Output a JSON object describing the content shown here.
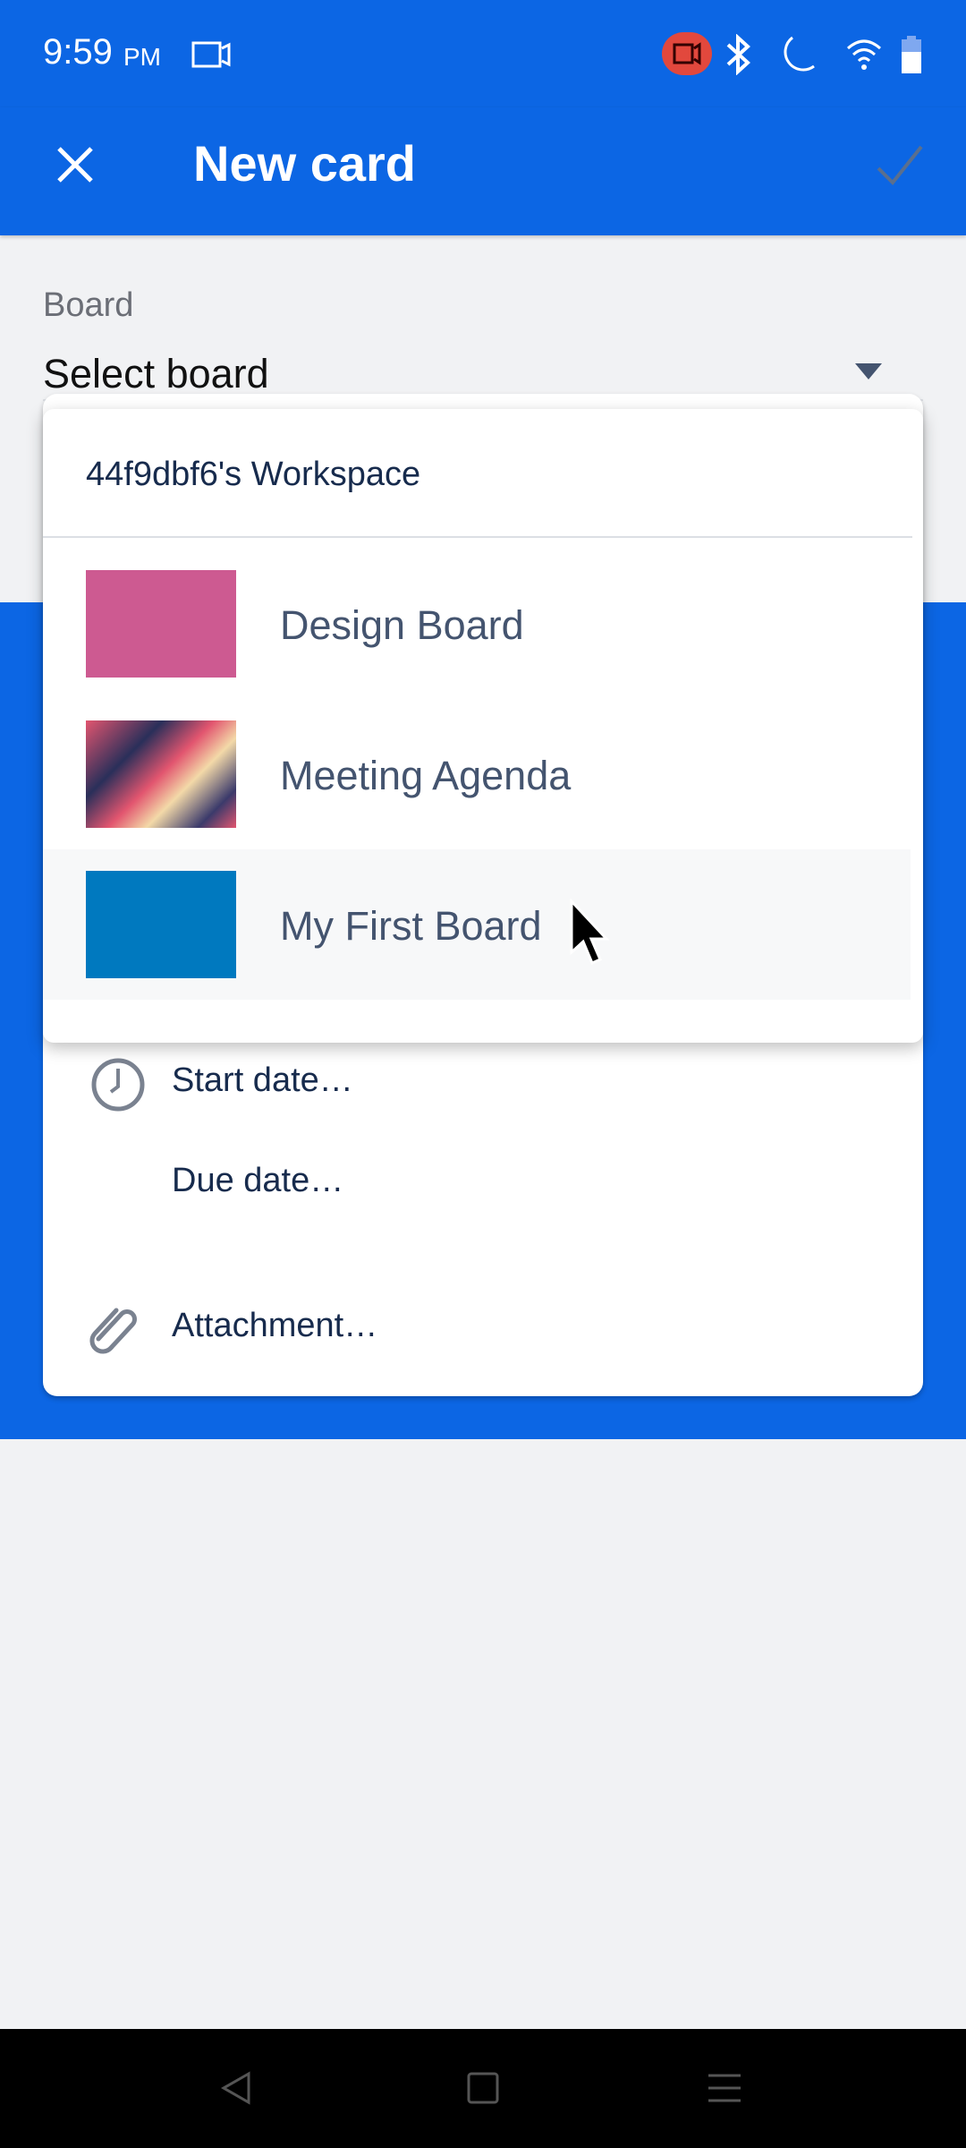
{
  "status_bar": {
    "time": "9:59",
    "ampm": "PM",
    "icons": [
      "screen-record-icon",
      "recording-icon",
      "bluetooth-icon",
      "do-not-disturb-icon",
      "wifi-icon",
      "battery-icon"
    ]
  },
  "app_bar": {
    "title": "New card",
    "close_icon": "close-icon",
    "confirm_icon": "check-icon"
  },
  "board_field": {
    "label": "Board",
    "value": "Select board"
  },
  "dropdown": {
    "workspace": "44f9dbf6's Workspace",
    "boards": [
      {
        "name": "Design Board",
        "color": "#cd5a91"
      },
      {
        "name": "Meeting Agenda",
        "color": "#e2556f"
      },
      {
        "name": "My First Board",
        "color": "#0079bf",
        "highlighted": true
      }
    ]
  },
  "options": {
    "start_date": "Start date…",
    "due_date": "Due date…",
    "attachment": "Attachment…"
  },
  "colors": {
    "primary": "#0c66e4",
    "background": "#f1f2f4"
  }
}
